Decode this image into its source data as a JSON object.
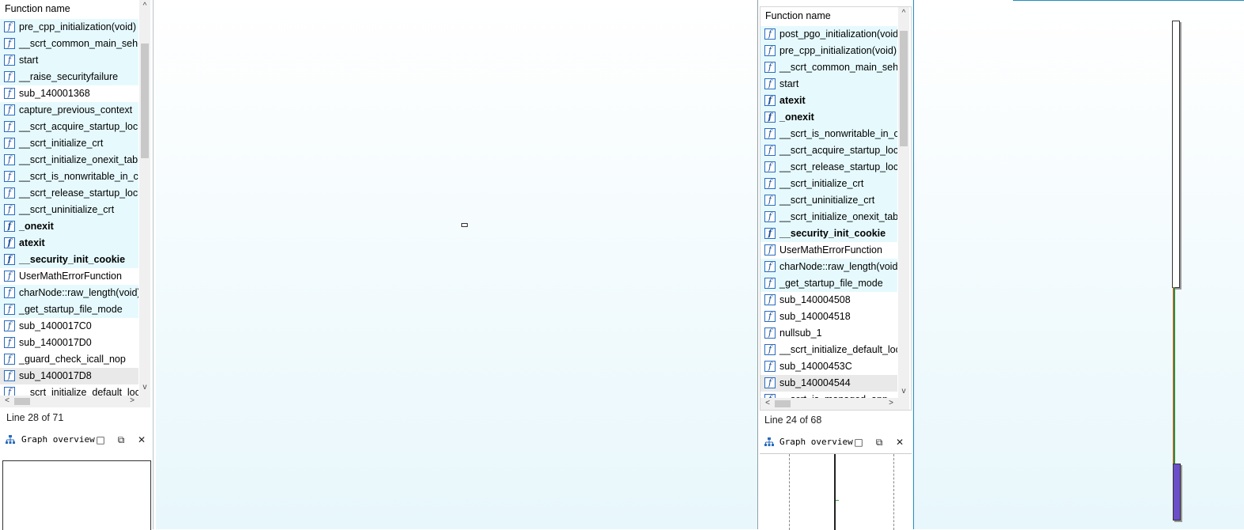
{
  "left_panel": {
    "header": "Function name",
    "rows": [
      {
        "label": "pre_cpp_initialization(void)",
        "bold": false,
        "hl": true
      },
      {
        "label": "__scrt_common_main_seh(void)",
        "bold": false,
        "hl": true
      },
      {
        "label": "start",
        "bold": false,
        "hl": true
      },
      {
        "label": "__raise_securityfailure",
        "bold": false,
        "hl": true
      },
      {
        "label": "sub_140001368",
        "bold": false,
        "hl": false
      },
      {
        "label": "capture_previous_context",
        "bold": false,
        "hl": true
      },
      {
        "label": "__scrt_acquire_startup_lock",
        "bold": false,
        "hl": true
      },
      {
        "label": "__scrt_initialize_crt",
        "bold": false,
        "hl": true
      },
      {
        "label": "__scrt_initialize_onexit_tables",
        "bold": false,
        "hl": true
      },
      {
        "label": "__scrt_is_nonwritable_in_current_image",
        "bold": false,
        "hl": true
      },
      {
        "label": "__scrt_release_startup_lock",
        "bold": false,
        "hl": true
      },
      {
        "label": "__scrt_uninitialize_crt",
        "bold": false,
        "hl": true
      },
      {
        "label": "_onexit",
        "bold": true,
        "hl": true
      },
      {
        "label": "atexit",
        "bold": true,
        "hl": true
      },
      {
        "label": "__security_init_cookie",
        "bold": true,
        "hl": true
      },
      {
        "label": "UserMathErrorFunction",
        "bold": false,
        "hl": false
      },
      {
        "label": "charNode::raw_length(void)",
        "bold": false,
        "hl": true
      },
      {
        "label": "_get_startup_file_mode",
        "bold": false,
        "hl": true
      },
      {
        "label": "sub_1400017C0",
        "bold": false,
        "hl": false
      },
      {
        "label": "sub_1400017D0",
        "bold": false,
        "hl": false
      },
      {
        "label": "_guard_check_icall_nop",
        "bold": false,
        "hl": false
      },
      {
        "label": "sub_1400017D8",
        "bold": false,
        "hl": false,
        "sel": true
      },
      {
        "label": "__scrt_initialize_default_local_stdio_options",
        "bold": false,
        "hl": false
      }
    ],
    "status": "Line 28 of 71",
    "overview_title": "Graph overview"
  },
  "right_panel": {
    "header": "Function name",
    "rows": [
      {
        "label": "post_pgo_initialization(void)",
        "bold": false,
        "hl": true
      },
      {
        "label": "pre_cpp_initialization(void)",
        "bold": false,
        "hl": true
      },
      {
        "label": "__scrt_common_main_seh(void)",
        "bold": false,
        "hl": true
      },
      {
        "label": "start",
        "bold": false,
        "hl": true
      },
      {
        "label": "atexit",
        "bold": true,
        "hl": true
      },
      {
        "label": "_onexit",
        "bold": true,
        "hl": true
      },
      {
        "label": "__scrt_is_nonwritable_in_current_image",
        "bold": false,
        "hl": true
      },
      {
        "label": "__scrt_acquire_startup_lock",
        "bold": false,
        "hl": true
      },
      {
        "label": "__scrt_release_startup_lock",
        "bold": false,
        "hl": true
      },
      {
        "label": "__scrt_initialize_crt",
        "bold": false,
        "hl": true
      },
      {
        "label": "__scrt_uninitialize_crt",
        "bold": false,
        "hl": true
      },
      {
        "label": "__scrt_initialize_onexit_tables",
        "bold": false,
        "hl": true
      },
      {
        "label": "__security_init_cookie",
        "bold": true,
        "hl": true
      },
      {
        "label": "UserMathErrorFunction",
        "bold": false,
        "hl": false
      },
      {
        "label": "charNode::raw_length(void)",
        "bold": false,
        "hl": true
      },
      {
        "label": "_get_startup_file_mode",
        "bold": false,
        "hl": true
      },
      {
        "label": "sub_140004508",
        "bold": false,
        "hl": false
      },
      {
        "label": "sub_140004518",
        "bold": false,
        "hl": false
      },
      {
        "label": "nullsub_1",
        "bold": false,
        "hl": false
      },
      {
        "label": "__scrt_initialize_default_local_stdio_options",
        "bold": false,
        "hl": false
      },
      {
        "label": "sub_14000453C",
        "bold": false,
        "hl": false
      },
      {
        "label": "sub_140004544",
        "bold": false,
        "hl": false,
        "sel": true
      },
      {
        "label": "__scrt_is_managed_app",
        "bold": false,
        "hl": false
      }
    ],
    "status": "Line 24 of 68",
    "overview_title": "Graph overview"
  },
  "icons": {
    "function": "function-icon",
    "overview": "graph-overview-icon",
    "maximize": "maximize-icon",
    "restore": "restore-icon",
    "close": "close-icon"
  },
  "glyphs": {
    "f": "f",
    "up": "^",
    "down": "v",
    "left": "<",
    "right": ">",
    "max": "□",
    "restore": "⧉",
    "close": "✕"
  },
  "colors": {
    "row_highlight": "#e6fafe",
    "row_selected": "#e9e9e9",
    "icon_border": "#2a6bbd",
    "graph_bg": "#e8f7fc"
  }
}
